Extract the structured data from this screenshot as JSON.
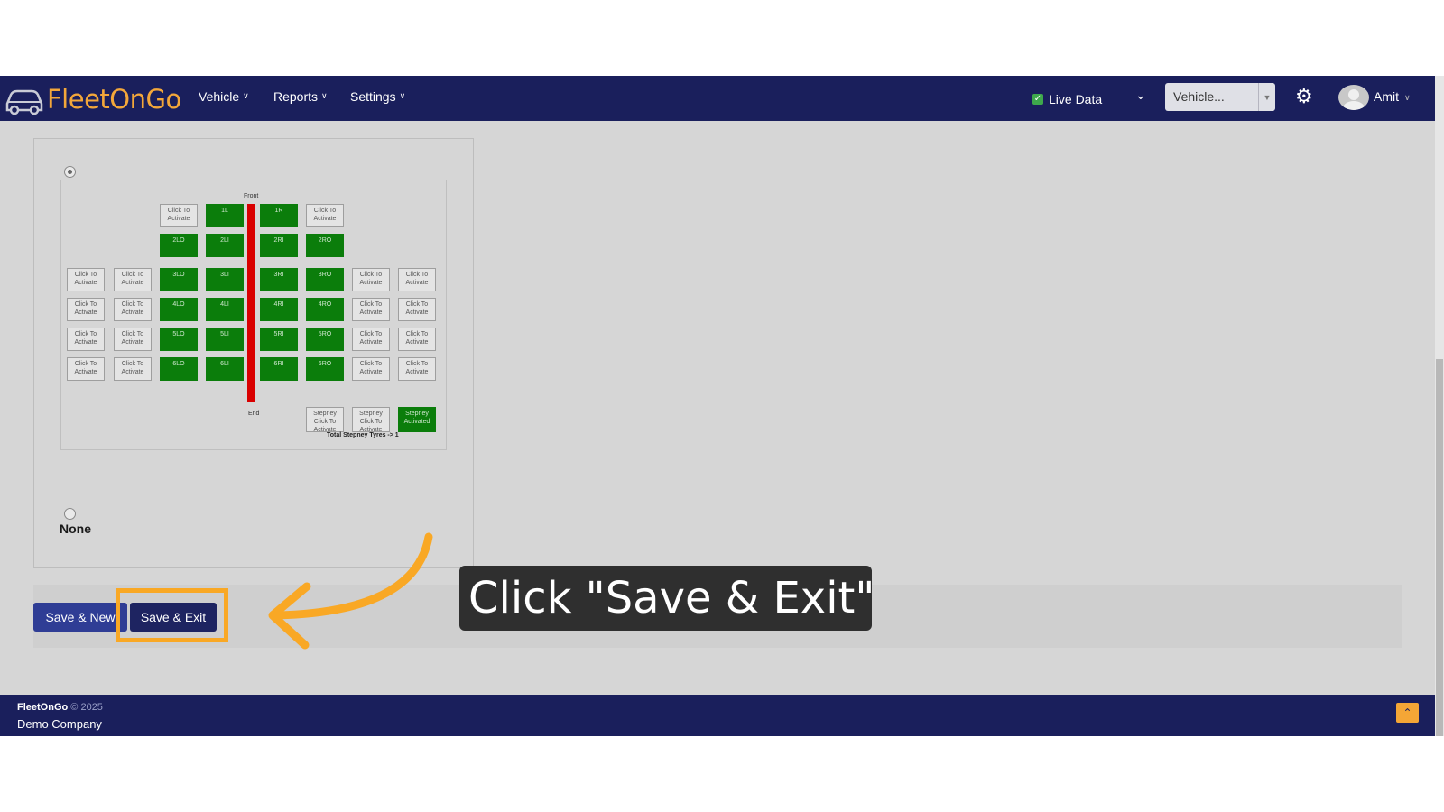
{
  "brand": {
    "name_part1": "Fleet",
    "name_part2": "On",
    "name_part3": "Go"
  },
  "nav": {
    "menus": [
      "Vehicle",
      "Reports",
      "Settings"
    ],
    "live_data_label": "Live Data",
    "vehicle_select_placeholder": "Vehicle...",
    "user_name": "Amit"
  },
  "tyre_layout": {
    "front_label": "Front",
    "end_label": "End",
    "inactive_label": "Click To Activate",
    "tyres": [
      "1L",
      "1R",
      "2LO",
      "2LI",
      "2RI",
      "2RO",
      "3LO",
      "3LI",
      "3RI",
      "3RO",
      "4LO",
      "4LI",
      "4RI",
      "4RO",
      "5LO",
      "5LI",
      "5RI",
      "5RO",
      "6LO",
      "6LI",
      "6RI",
      "6RO"
    ],
    "stepney_inactive": "Stepney Click To Activate",
    "stepney_active": "Stepney Activated",
    "stepney_total": "Total Stepney Tyres -> 1"
  },
  "option_none_label": "None",
  "buttons": {
    "save_new": "Save & New",
    "save_exit": "Save & Exit"
  },
  "callout_text": "Click \"Save & Exit\"",
  "footer": {
    "brand": "FleetOnGo",
    "copyright": "© 2025",
    "company": "Demo Company"
  },
  "colors": {
    "navbar": "#1a1f5c",
    "brand_accent": "#f3a73a",
    "tyre_active": "#0b7d0b",
    "axle": "#d90000",
    "highlight": "#f9a825"
  }
}
